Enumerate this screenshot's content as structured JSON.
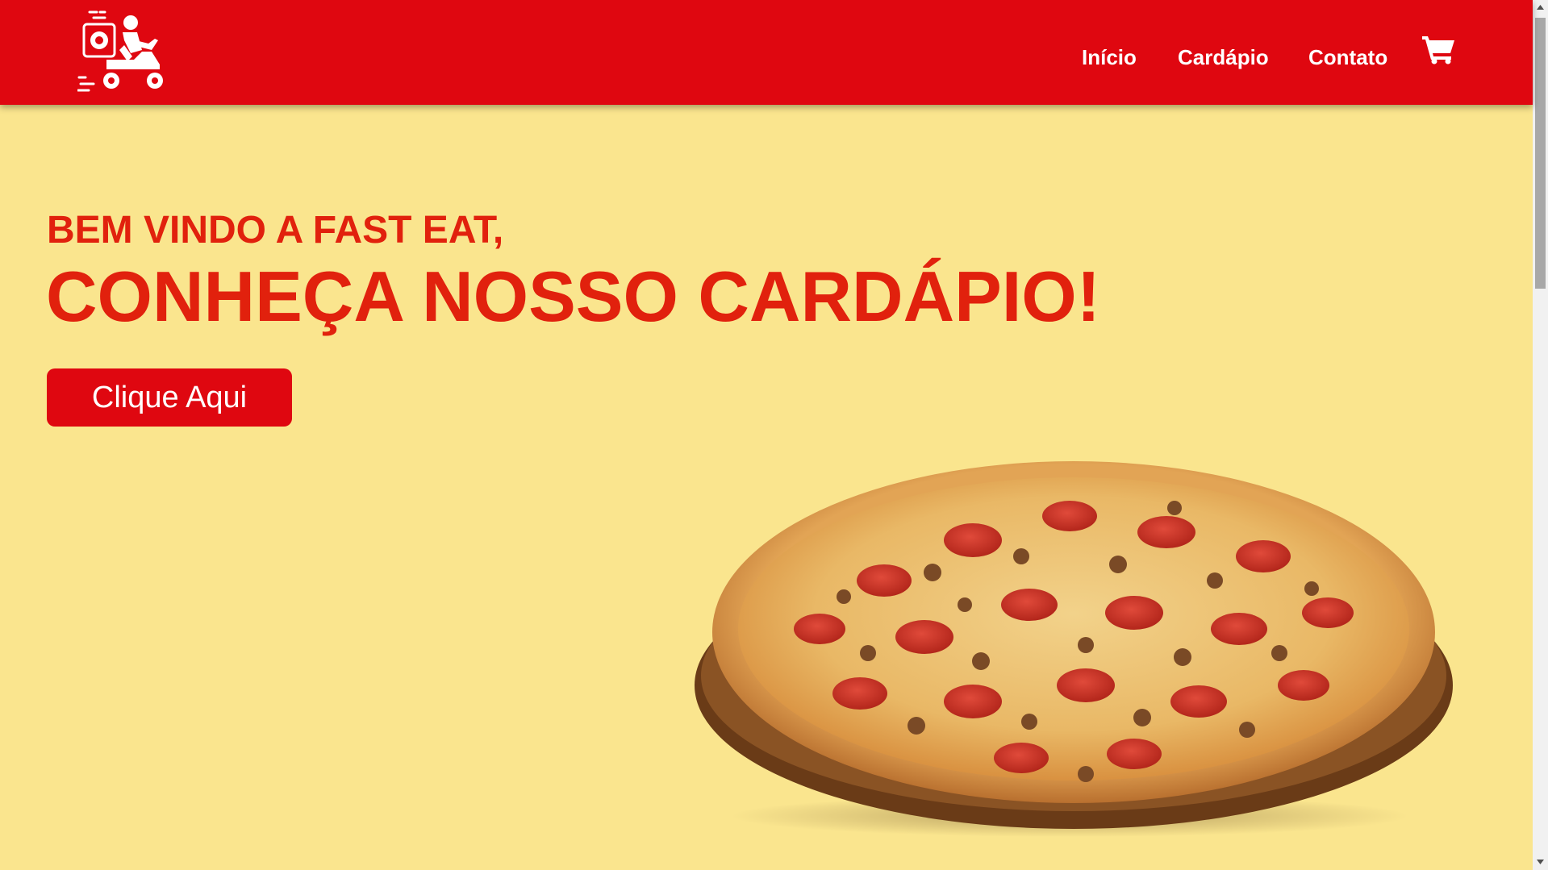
{
  "header": {
    "logo_icon": "delivery-scooter-icon",
    "nav": [
      {
        "label": "Início"
      },
      {
        "label": "Cardápio"
      },
      {
        "label": "Contato"
      }
    ],
    "cart_icon": "shopping-cart-icon"
  },
  "hero": {
    "subtitle": "BEM VINDO A FAST EAT,",
    "title": "CONHEÇA NOSSO CARDÁPIO!",
    "cta_label": "Clique Aqui",
    "image_icon": "pizza-image"
  },
  "colors": {
    "brand_red": "#DF0710",
    "headline_red": "#E1210D",
    "background_yellow": "#FAE58E"
  },
  "scrollbar": {
    "up_icon": "scroll-up-arrow-icon",
    "down_icon": "scroll-down-arrow-icon"
  }
}
